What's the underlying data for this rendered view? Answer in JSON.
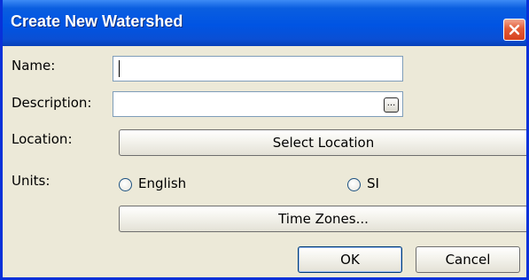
{
  "window": {
    "title": "Create New Watershed",
    "close_icon": "close-icon"
  },
  "form": {
    "name_label": "Name:",
    "name_value": "",
    "description_label": "Description:",
    "description_value": "",
    "description_browse_label": "...",
    "location_label": "Location:",
    "select_location_label": "Select Location",
    "units_label": "Units:",
    "units_options": [
      "English",
      "SI"
    ],
    "units_selected": null,
    "time_zones_label": "Time Zones..."
  },
  "buttons": {
    "ok_label": "OK",
    "cancel_label": "Cancel"
  },
  "colors": {
    "title_bar": "#0054e3",
    "window_border": "#0831d9",
    "client_bg": "#ece9d8",
    "close_button": "#e35b36"
  }
}
